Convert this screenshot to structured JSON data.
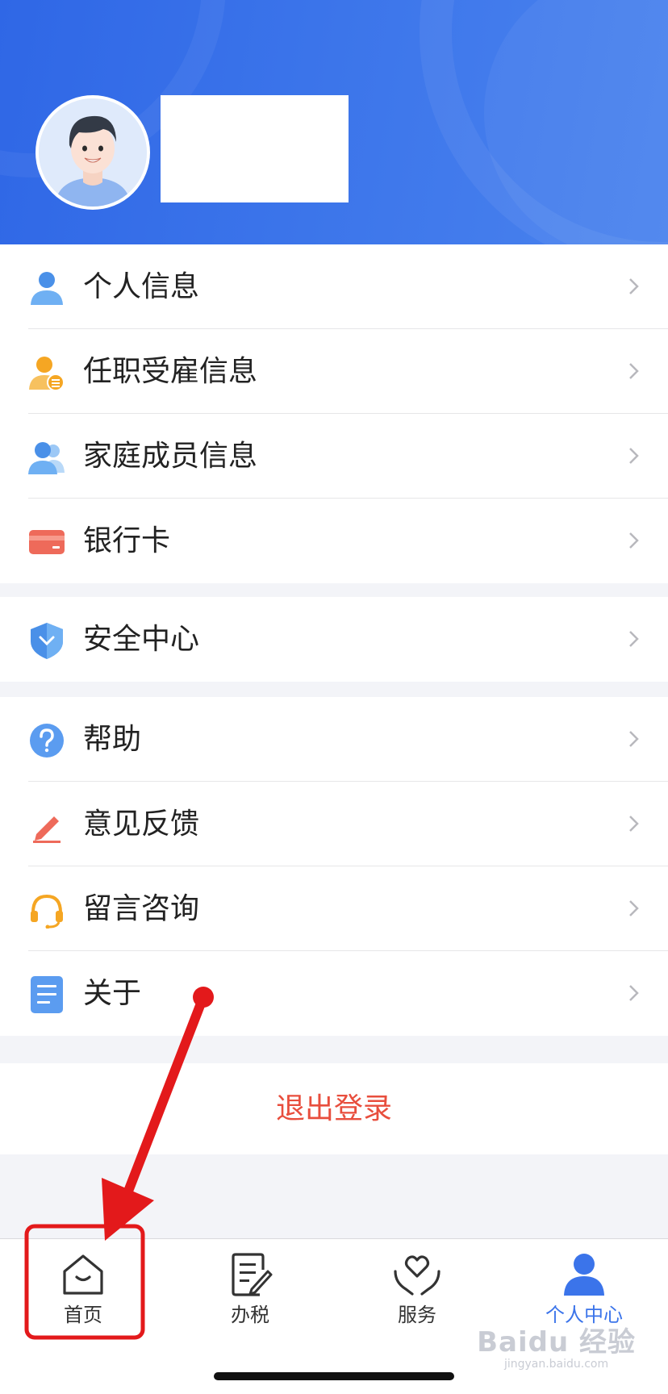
{
  "header": {
    "bg_color": "#3b74ea",
    "avatar_icon": "user-avatar-illustration"
  },
  "profile_group": [
    {
      "label": "个人信息",
      "icon": "person-icon",
      "color": "#4a90e8"
    },
    {
      "label": "任职受雇信息",
      "icon": "employment-icon",
      "color": "#f5a623"
    },
    {
      "label": "家庭成员信息",
      "icon": "family-icon",
      "color": "#4a90e8"
    },
    {
      "label": "银行卡",
      "icon": "bank-card-icon",
      "color": "#ee6a5a"
    }
  ],
  "security_group": [
    {
      "label": "安全中心",
      "icon": "shield-icon",
      "color": "#4a90e8"
    }
  ],
  "support_group": [
    {
      "label": "帮助",
      "icon": "help-icon",
      "color": "#4a90e8"
    },
    {
      "label": "意见反馈",
      "icon": "feedback-pen-icon",
      "color": "#ee6a5a"
    },
    {
      "label": "留言咨询",
      "icon": "headset-icon",
      "color": "#f5a623"
    },
    {
      "label": "关于",
      "icon": "document-icon",
      "color": "#4a90e8"
    }
  ],
  "logout_label": "退出登录",
  "tabbar": {
    "active_color": "#3b74ea",
    "tabs": [
      {
        "label": "首页",
        "icon": "home-icon"
      },
      {
        "label": "办税",
        "icon": "tax-form-icon"
      },
      {
        "label": "服务",
        "icon": "heart-hands-icon"
      },
      {
        "label": "个人中心",
        "icon": "person-filled-icon",
        "active": true
      }
    ]
  },
  "annotation": {
    "color": "#e3191b",
    "shape": "red arrow pointing to home tab inside red rounded box"
  },
  "watermark": {
    "main": "Baidu 经验",
    "sub": "jingyan.baidu.com"
  }
}
